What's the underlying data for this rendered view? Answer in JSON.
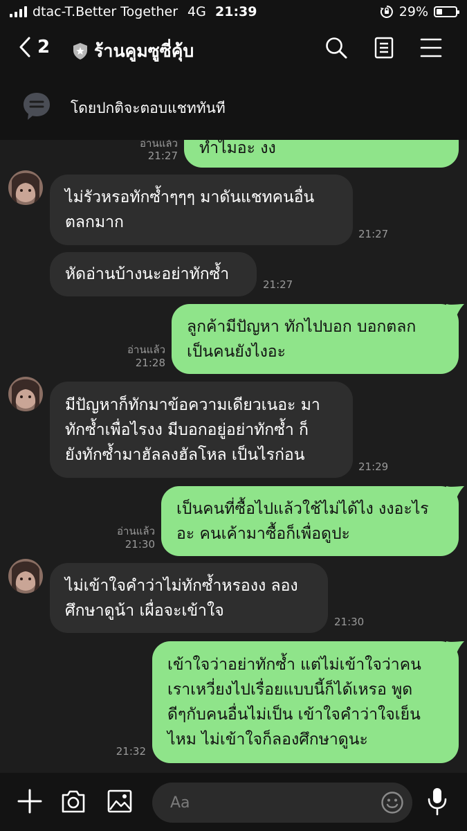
{
  "status_bar": {
    "carrier": "dtac-T.Better Together",
    "network": "4G",
    "time": "21:39",
    "battery": "29%",
    "battery_level": 0.29
  },
  "header": {
    "back_count": "2",
    "title": "ร้านคูมซูซี่คุ้บ",
    "icons": [
      "back-chevron-icon",
      "shield-star-icon",
      "search-icon",
      "notes-icon",
      "menu-icon"
    ]
  },
  "notice": {
    "text": "โดยปกติจะตอบแชททันที",
    "icon": "chat-bubble-icon"
  },
  "colors": {
    "outgoing_bubble": "#8fe48a",
    "incoming_bubble": "#2e2e2e",
    "background": "#1d1d1d",
    "header": "#131313"
  },
  "messages": [
    {
      "id": "m0",
      "side": "out",
      "text": "ทำไมอะ งง",
      "read": "อ่านแล้ว",
      "time": "21:27"
    },
    {
      "id": "m1",
      "side": "in",
      "text": "ไม่รัวหรอทักซ้ำๆๆๆ มาดันแชทคนอื่น\nตลกมาก",
      "time": "21:27"
    },
    {
      "id": "m2",
      "side": "in",
      "text": "หัดอ่านบ้างนะอย่าทักซ้ำ",
      "time": "21:27"
    },
    {
      "id": "m3",
      "side": "out",
      "text": "ลูกค้ามีปัญหา ทักไปบอก บอกตลก\nเป็นคนยังไงอะ",
      "read": "อ่านแล้ว",
      "time": "21:28"
    },
    {
      "id": "m4",
      "side": "in",
      "text": "มีปัญหาก็ทักมาข้อความเดียวเนอะ มา\nทักซ้ำเพื่อไรงง มีบอกอยู่อย่าทักซ้ำ ก็\nยังทักซ้ำมาฮัลลงฮัลโหล เป็นไรก่อน",
      "time": "21:29"
    },
    {
      "id": "m5",
      "side": "out",
      "text": "เป็นคนที่ซื้อไปแล้วใช้ไม่ได้ไง งงอะไร\nอะ คนเค้ามาซื้อก็เพื่อดูปะ",
      "read": "อ่านแล้ว",
      "time": "21:30"
    },
    {
      "id": "m6",
      "side": "in",
      "text": "ไม่เข้าใจคำว่าไม่ทักซ้ำหรองง ลอง\nศึกษาดูน้า เผื่อจะเข้าใจ",
      "time": "21:30"
    },
    {
      "id": "m7",
      "side": "out",
      "text": "เข้าใจว่าอย่าทักซ้ำ แต่ไม่เข้าใจว่าคน\nเราเหวี่ยงไปเรื่อยแบบนี้ก็ได้เหรอ พูด\nดีๆกับคนอื่นไม่เป็น เข้าใจคำว่าใจเย็น\nไหม ไม่เข้าใจก็ลองศึกษาดูนะ",
      "time": "21:32"
    }
  ],
  "composer": {
    "placeholder": "Aa",
    "icons": [
      "plus-icon",
      "camera-icon",
      "image-icon",
      "emoji-icon",
      "microphone-icon"
    ]
  }
}
